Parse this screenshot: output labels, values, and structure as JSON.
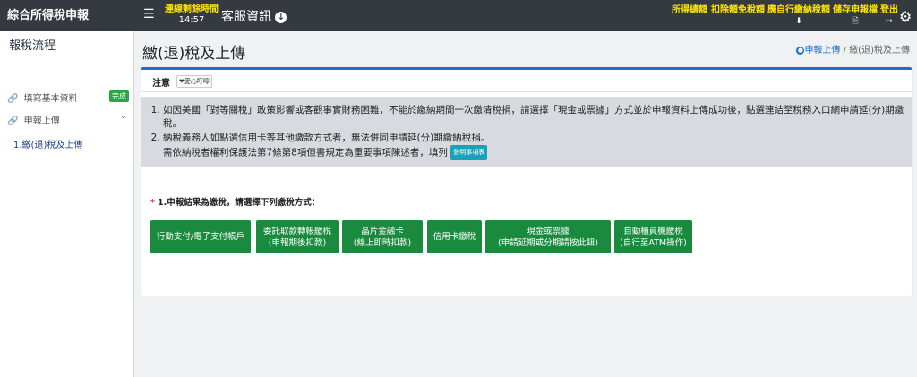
{
  "header": {
    "brand": "綜合所得稅申報",
    "session_label": "連線剩餘時間",
    "session_time": "14:57",
    "service": "客服資訊",
    "summary": [
      {
        "label": "所得總額",
        "sub": ""
      },
      {
        "label": "扣除額免稅額",
        "sub": ""
      },
      {
        "label": "應自行繳納稅額",
        "sub": ""
      },
      {
        "label": "儲存申報檔",
        "sub": ""
      },
      {
        "label": "登出",
        "sub": ""
      }
    ]
  },
  "sidebar": {
    "title": "報稅流程",
    "items": [
      {
        "label": "填寫基本資料",
        "badge": "完成"
      },
      {
        "label": "申報上傳"
      }
    ],
    "sub_item": "1.繳(退)稅及上傳"
  },
  "main": {
    "title": "繳(退)稅及上傳",
    "breadcrumb": {
      "home": "申報上傳",
      "sep": "/",
      "current": "繳(退)稅及上傳"
    },
    "notice_title": "注意",
    "notice_tag": "❤愛心叮嚀",
    "notes": [
      "如因美國「對等關稅」政策影響或客觀事實財務困難，不能於繳納期間一次繳清稅捐，請選擇「現金或票據」方式並於申報資料上傳成功後，點選連結至稅務入口網申請延(分)期繳稅。",
      "納稅義務人如點選信用卡等其他繳款方式者，無法併同申請延(分)期繳納稅捐。"
    ],
    "note2_extra": "需依納稅者權利保護法第7條第8項但書規定為重要事項陳述者，填列",
    "note2_tag": "聲明事項表",
    "method_label": "1.申報結果為繳稅，請選擇下列繳稅方式：",
    "buttons": [
      {
        "line1": "行動支付/電子支付帳戶",
        "line2": ""
      },
      {
        "line1": "委託取款轉帳繳稅",
        "line2": "(申報期後扣款)"
      },
      {
        "line1": "晶片金融卡",
        "line2": "(線上即時扣款)"
      },
      {
        "line1": "信用卡繳稅",
        "line2": ""
      },
      {
        "line1": "現金或票據",
        "line2": "(申請延期或分期請按此鈕)"
      },
      {
        "line1": "自動櫃員機繳稅",
        "line2": "(自行至ATM操作)"
      }
    ]
  }
}
